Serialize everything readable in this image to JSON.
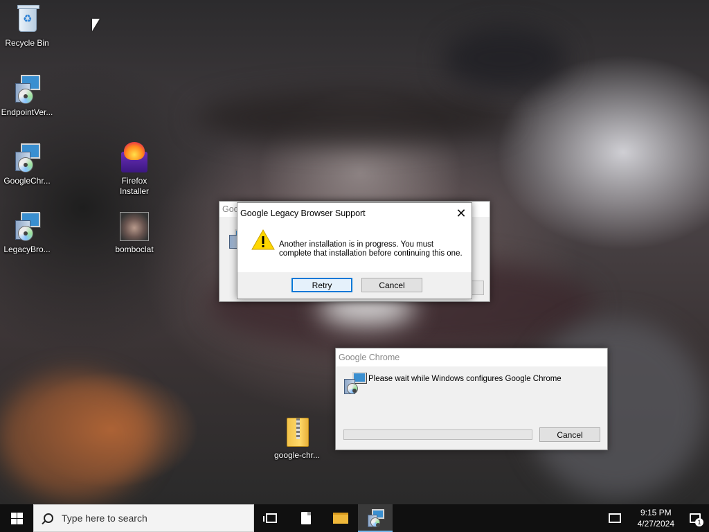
{
  "desktop": {
    "icons": [
      {
        "label": "Recycle Bin",
        "icon": "recycle-bin-icon"
      },
      {
        "label": "EndpointVer...",
        "icon": "installer-icon"
      },
      {
        "label": "GoogleChr...",
        "icon": "installer-icon"
      },
      {
        "label": "LegacyBro...",
        "icon": "installer-icon"
      },
      {
        "label": "Firefox Installer",
        "icon": "firefox-installer-icon"
      },
      {
        "label": "bomboclat",
        "icon": "photo-icon"
      },
      {
        "label": "google-chr...",
        "icon": "zip-folder-icon"
      }
    ]
  },
  "background_window": {
    "title": "Goog"
  },
  "legacy_dialog": {
    "title": "Google Legacy Browser Support",
    "message": "Another installation is in progress. You must complete that installation before continuing this one.",
    "retry_label": "Retry",
    "cancel_label": "Cancel",
    "icon": "warning-icon"
  },
  "chrome_dialog": {
    "title": "Google Chrome",
    "message": "Please wait while Windows configures Google Chrome",
    "cancel_label": "Cancel",
    "icon": "installer-icon",
    "progress": 0
  },
  "taskbar": {
    "search_placeholder": "Type here to search",
    "time": "9:15 PM",
    "date": "4/27/2024",
    "notification_count": "1"
  },
  "colors": {
    "accent": "#0078d7",
    "taskbar": "#101010"
  }
}
